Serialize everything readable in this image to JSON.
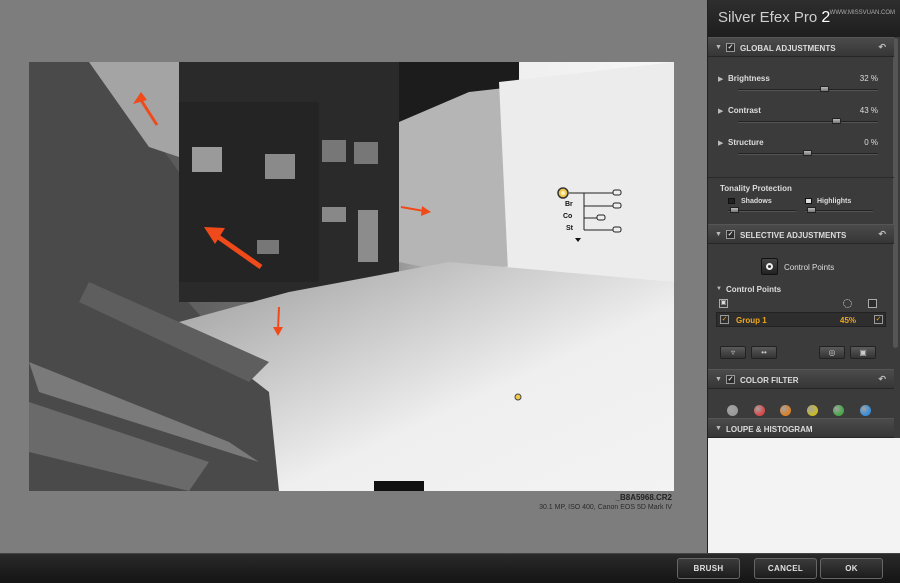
{
  "app": {
    "title_main": "Silver Efex Pro",
    "title_version": "2",
    "watermark": "WWW.MISSVUAN.COM"
  },
  "image": {
    "filename": "_B8A5968.CR2",
    "info": "30.1 MP, ISO 400, Canon EOS 5D Mark IV"
  },
  "control_point_overlay": {
    "rows": [
      "Br",
      "Co",
      "St"
    ]
  },
  "global_adjustments": {
    "title": "GLOBAL ADJUSTMENTS",
    "sliders": [
      {
        "name": "Brightness",
        "value": "32 %",
        "level": 0.62
      },
      {
        "name": "Contrast",
        "value": "43 %",
        "level": 0.71
      },
      {
        "name": "Structure",
        "value": "0 %",
        "level": 0.5
      }
    ],
    "tonality": {
      "title": "Tonality Protection",
      "shadows": "Shadows",
      "highlights": "Highlights",
      "shadows_level": 0.1,
      "highlights_level": 0.1
    }
  },
  "selective_adjustments": {
    "title": "SELECTIVE ADJUSTMENTS",
    "control_points_button": "Control Points",
    "control_points_header": "Control Points",
    "groups": [
      {
        "name": "Group 1",
        "value": "45%"
      }
    ]
  },
  "color_filter": {
    "title": "COLOR FILTER",
    "colors": [
      "#9a9a9a",
      "#d94a4a",
      "#d9822a",
      "#c9b92a",
      "#4aa84a",
      "#3a8ed9"
    ]
  },
  "loupe": {
    "title": "LOUPE & HISTOGRAM"
  },
  "bottom_buttons": {
    "brush": "BRUSH",
    "cancel": "CANCEL",
    "ok": "OK"
  }
}
